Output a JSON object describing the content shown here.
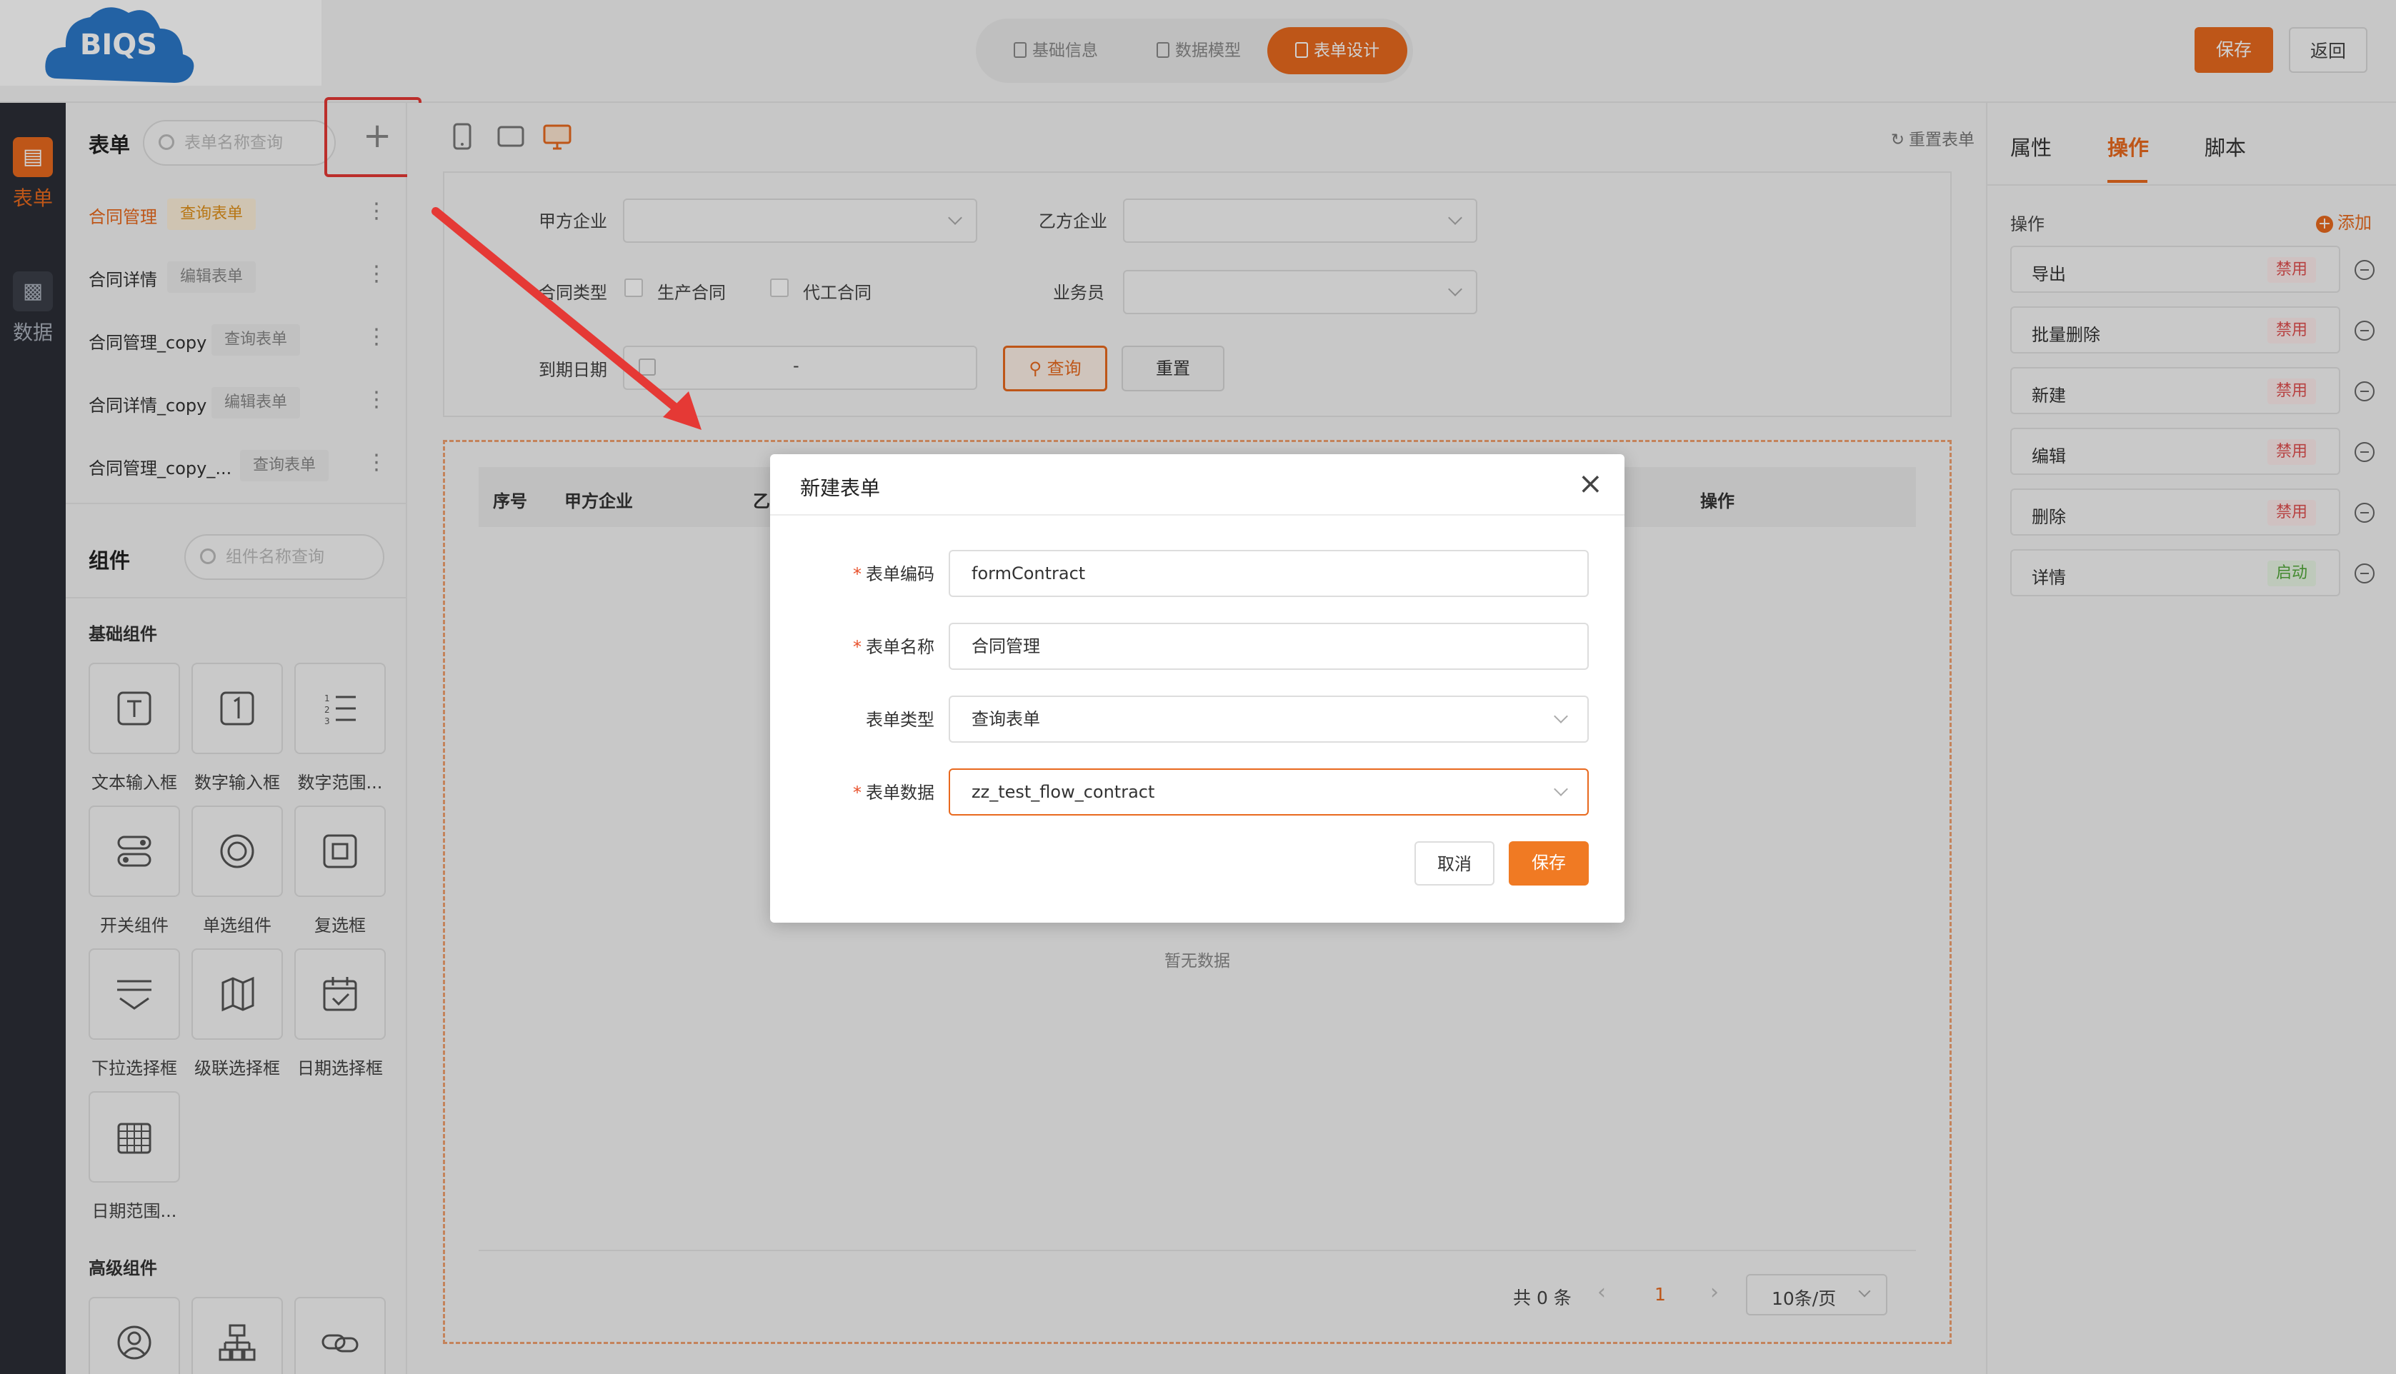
{
  "header": {
    "logo_text": "BIQS",
    "steps": [
      {
        "label": "基础信息",
        "active": false
      },
      {
        "label": "数据模型",
        "active": false
      },
      {
        "label": "表单设计",
        "active": true
      }
    ],
    "save_label": "保存",
    "back_label": "返回"
  },
  "left_nav": [
    {
      "label": "表单",
      "icon": "form-icon",
      "active": true
    },
    {
      "label": "数据",
      "icon": "data-chart-icon",
      "active": false
    }
  ],
  "forms_panel": {
    "title": "表单",
    "search_placeholder": "表单名称查询",
    "add_icon": "plus-icon",
    "items": [
      {
        "name": "合同管理",
        "tag": "查询表单",
        "active": true
      },
      {
        "name": "合同详情",
        "tag": "编辑表单",
        "active": false
      },
      {
        "name": "合同管理_copy",
        "tag": "查询表单",
        "active": false
      },
      {
        "name": "合同详情_copy",
        "tag": "编辑表单",
        "active": false
      },
      {
        "name": "合同管理_copy_...",
        "tag": "查询表单",
        "active": false
      }
    ]
  },
  "components": {
    "title": "组件",
    "search_placeholder": "组件名称查询",
    "basic_title": "基础组件",
    "basic": [
      {
        "label": "文本输入框",
        "icon": "text-input-icon"
      },
      {
        "label": "数字输入框",
        "icon": "number-input-icon"
      },
      {
        "label": "数字范围...",
        "icon": "number-range-icon"
      },
      {
        "label": "开关组件",
        "icon": "switch-icon"
      },
      {
        "label": "单选组件",
        "icon": "radio-icon"
      },
      {
        "label": "复选框",
        "icon": "checkbox-icon"
      },
      {
        "label": "下拉选择框",
        "icon": "dropdown-icon"
      },
      {
        "label": "级联选择框",
        "icon": "cascader-icon"
      },
      {
        "label": "日期选择框",
        "icon": "date-picker-icon"
      },
      {
        "label": "日期范围...",
        "icon": "date-range-icon"
      }
    ],
    "advanced_title": "高级组件",
    "advanced": [
      {
        "icon": "user-icon"
      },
      {
        "icon": "org-tree-icon"
      },
      {
        "icon": "link-icon"
      }
    ]
  },
  "canvas": {
    "reset_label": "重置表单",
    "query": {
      "party_a_label": "甲方企业",
      "party_b_label": "乙方企业",
      "contract_type_label": "合同类型",
      "contract_type_options": [
        "生产合同",
        "代工合同"
      ],
      "salesperson_label": "业务员",
      "due_date_label": "到期日期",
      "date_separator": "-",
      "search_button": "查询",
      "reset_button": "重置"
    },
    "table": {
      "columns": [
        "序号",
        "甲方企业",
        "乙",
        "操作"
      ],
      "empty_text": "暂无数据",
      "total_text": "共 0 条",
      "current_page": "1",
      "page_size": "10条/页"
    }
  },
  "right_panel": {
    "tabs": [
      {
        "label": "属性",
        "active": false
      },
      {
        "label": "操作",
        "active": true
      },
      {
        "label": "脚本",
        "active": false
      }
    ],
    "section_label": "操作",
    "add_label": "添加",
    "operations": [
      {
        "name": "导出",
        "status": "禁用",
        "enabled": false
      },
      {
        "name": "批量删除",
        "status": "禁用",
        "enabled": false
      },
      {
        "name": "新建",
        "status": "禁用",
        "enabled": false
      },
      {
        "name": "编辑",
        "status": "禁用",
        "enabled": false
      },
      {
        "name": "删除",
        "status": "禁用",
        "enabled": false
      },
      {
        "name": "详情",
        "status": "启动",
        "enabled": true
      }
    ]
  },
  "dialog": {
    "title": "新建表单",
    "fields": [
      {
        "label": "表单编码",
        "required": true,
        "value": "formContract",
        "type": "input"
      },
      {
        "label": "表单名称",
        "required": true,
        "value": "合同管理",
        "type": "input"
      },
      {
        "label": "表单类型",
        "required": false,
        "value": "查询表单",
        "type": "select"
      },
      {
        "label": "表单数据",
        "required": true,
        "value": "zz_test_flow_contract",
        "type": "select"
      }
    ],
    "cancel_label": "取消",
    "save_label": "保存"
  },
  "colors": {
    "accent": "#e8691e",
    "highlight_box": "#e53935",
    "annotation_arrow": "#e53935"
  }
}
